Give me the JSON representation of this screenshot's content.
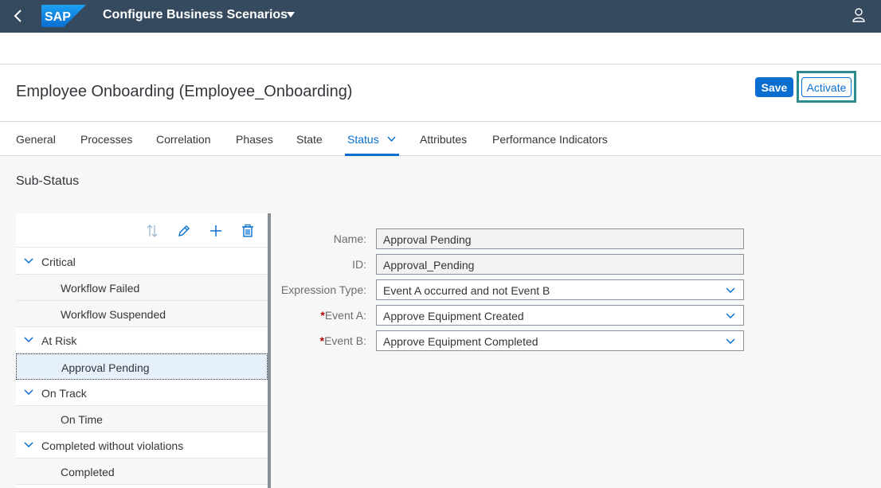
{
  "shell": {
    "logo_text": "SAP",
    "title": "Configure Business Scenarios"
  },
  "header": {
    "title": "Employee Onboarding (Employee_Onboarding)",
    "save_label": "Save",
    "activate_label": "Activate"
  },
  "tabs": [
    {
      "label": "General"
    },
    {
      "label": "Processes"
    },
    {
      "label": "Correlation"
    },
    {
      "label": "Phases"
    },
    {
      "label": "State"
    },
    {
      "label": "Status"
    },
    {
      "label": "Attributes"
    },
    {
      "label": "Performance Indicators"
    }
  ],
  "section_title": "Sub-Status",
  "tree": {
    "rows": [
      {
        "label": "Critical",
        "kind": "group"
      },
      {
        "label": "Workflow Failed",
        "kind": "leaf"
      },
      {
        "label": "Workflow Suspended",
        "kind": "leaf"
      },
      {
        "label": "At Risk",
        "kind": "group"
      },
      {
        "label": "Approval Pending",
        "kind": "leaf",
        "selected": true
      },
      {
        "label": "On Track",
        "kind": "group"
      },
      {
        "label": "On Time",
        "kind": "leaf"
      },
      {
        "label": "Completed without violations",
        "kind": "group"
      },
      {
        "label": "Completed",
        "kind": "leaf"
      }
    ],
    "toolbar_icons": [
      "sort-icon",
      "edit-icon",
      "add-icon",
      "delete-icon"
    ]
  },
  "form": {
    "name_label": "Name:",
    "name_value": "Approval Pending",
    "id_label": "ID:",
    "id_value": "Approval_Pending",
    "expr_label": "Expression Type:",
    "expr_value": "Event A occurred and not Event B",
    "event_a_label": "Event A:",
    "event_a_value": "Approve Equipment Created",
    "event_b_label": "Event B:",
    "event_b_value": "Approve Equipment Completed",
    "required_marker": "*"
  },
  "colors": {
    "shell_bg": "#354a5f",
    "accent": "#0a6ed1",
    "highlight_border": "#2c8c8c",
    "required": "#bb0000"
  }
}
